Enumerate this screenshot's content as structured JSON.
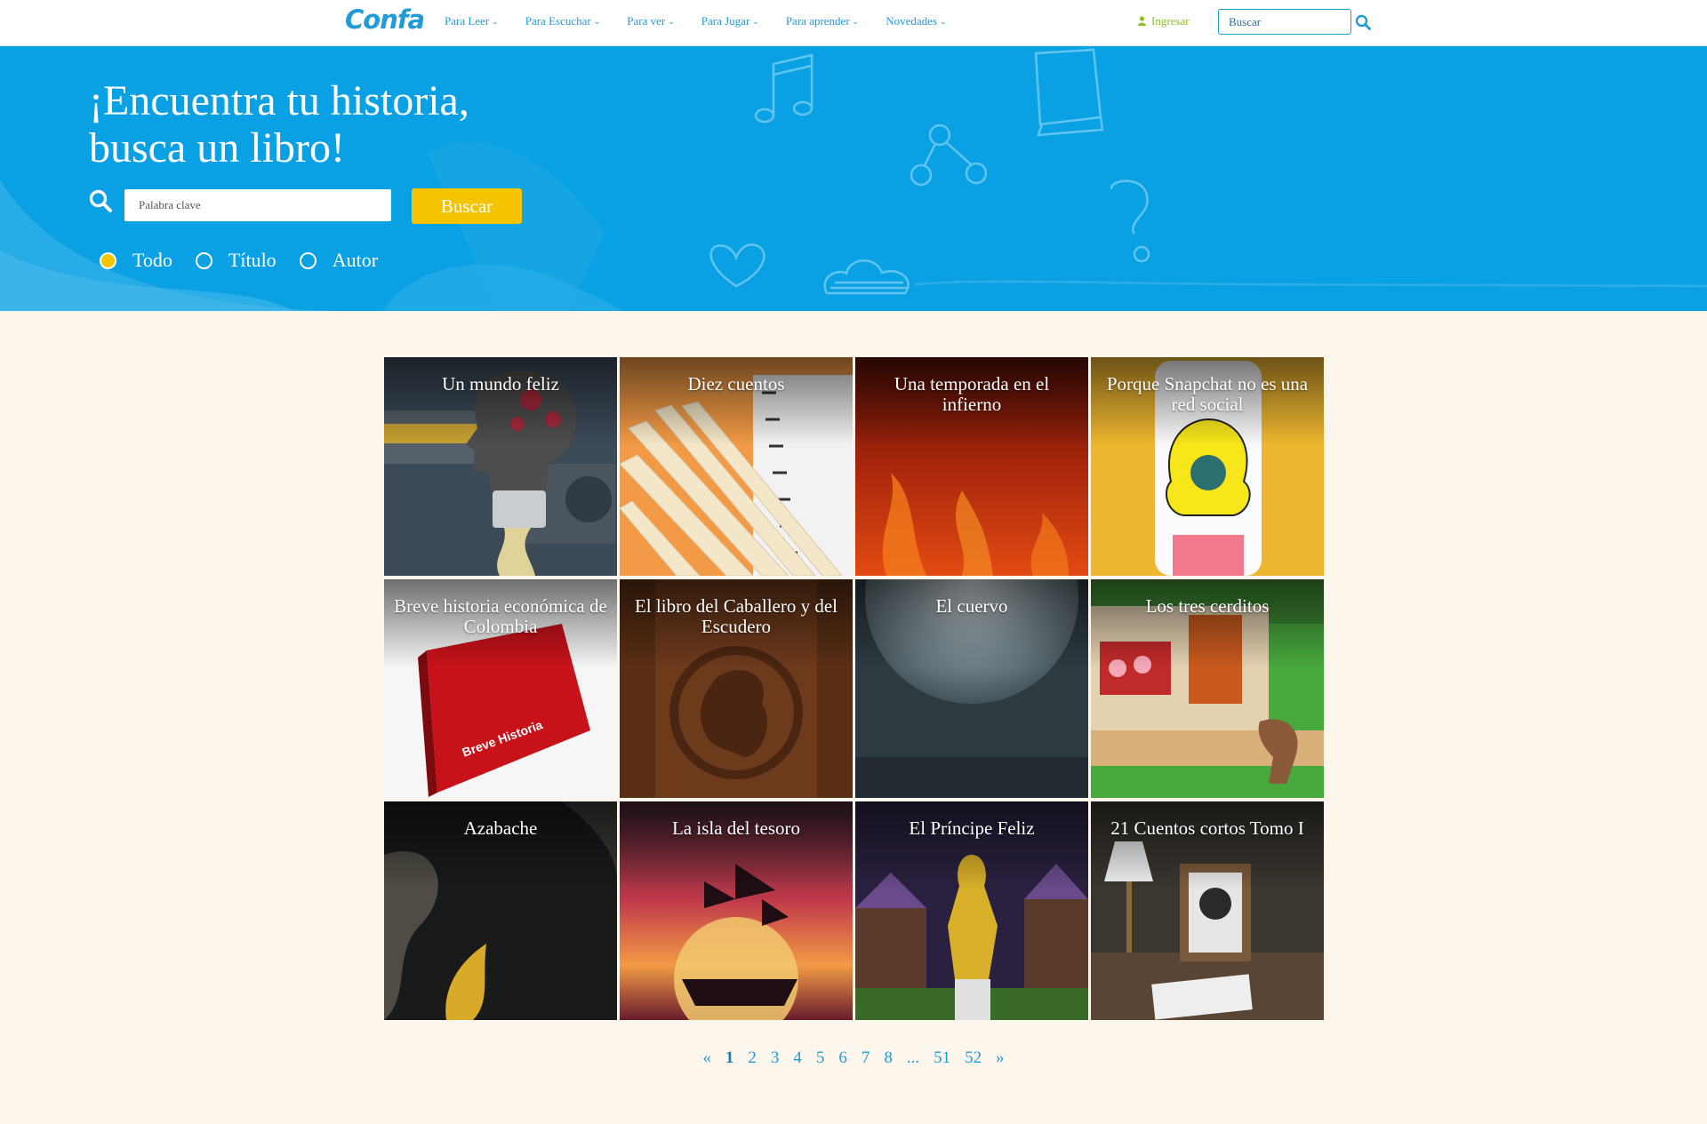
{
  "nav": {
    "logo": "Confa",
    "menu": [
      {
        "label": "Para Leer"
      },
      {
        "label": "Para Escuchar"
      },
      {
        "label": "Para ver"
      },
      {
        "label": "Para Jugar"
      },
      {
        "label": "Para aprender"
      },
      {
        "label": "Novedades"
      }
    ],
    "login": "Ingresar",
    "search_placeholder": "Buscar"
  },
  "hero": {
    "title_line1": "¡Encuentra tu historia,",
    "title_line2": "busca un libro!",
    "search_placeholder": "Palabra clave",
    "search_button": "Buscar",
    "filters": [
      {
        "label": "Todo",
        "selected": true
      },
      {
        "label": "Título",
        "selected": false
      },
      {
        "label": "Autor",
        "selected": false
      }
    ]
  },
  "books": [
    {
      "title": "Un mundo feliz"
    },
    {
      "title": "Diez cuentos"
    },
    {
      "title": "Una temporada en el infierno"
    },
    {
      "title": "Porque Snapchat no es una red social"
    },
    {
      "title": "Breve historia económica de Colombia"
    },
    {
      "title": "El libro del Caballero y del Escudero"
    },
    {
      "title": "El cuervo"
    },
    {
      "title": "Los tres cerditos"
    },
    {
      "title": "Azabache"
    },
    {
      "title": "La isla del tesoro"
    },
    {
      "title": "El Príncipe Feliz"
    },
    {
      "title": "21 Cuentos cortos Tomo I"
    }
  ],
  "pagination": {
    "prev": "«",
    "pages": [
      "1",
      "2",
      "3",
      "4",
      "5",
      "6",
      "7",
      "8",
      "...",
      "51",
      "52"
    ],
    "current": "1",
    "next": "»"
  },
  "colors": {
    "accent": "#1f9bd7",
    "hero_bg": "#0aa0e4",
    "button": "#f4c400",
    "login": "#8cbf26",
    "page_bg": "#fdf6ec"
  }
}
